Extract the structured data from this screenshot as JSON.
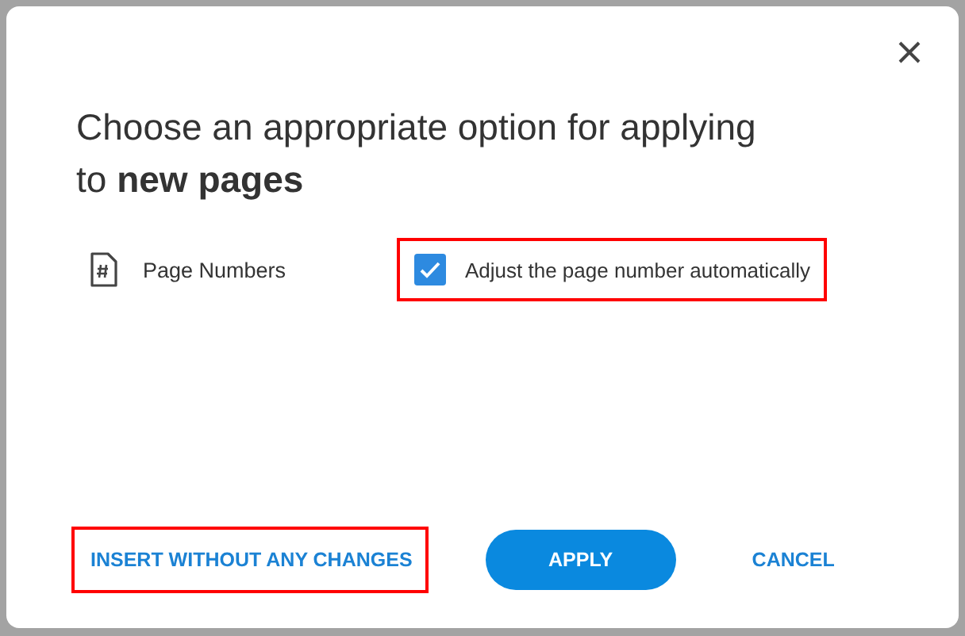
{
  "dialog": {
    "title": "Choose an appropriate option for applying to **new pages**",
    "options": [
      {
        "label": "Page Numbers",
        "setting": "Adjust the page number automatically",
        "checked": true,
        "highlighted": true
      }
    ],
    "buttons": [
      {
        "label": "INSERT WITHOUT ANY CHANGES",
        "kind": "text",
        "highlighted": true
      },
      {
        "label": "APPLY",
        "kind": "primary",
        "highlighted": false
      },
      {
        "label": "CANCEL",
        "kind": "text",
        "highlighted": false
      }
    ]
  }
}
